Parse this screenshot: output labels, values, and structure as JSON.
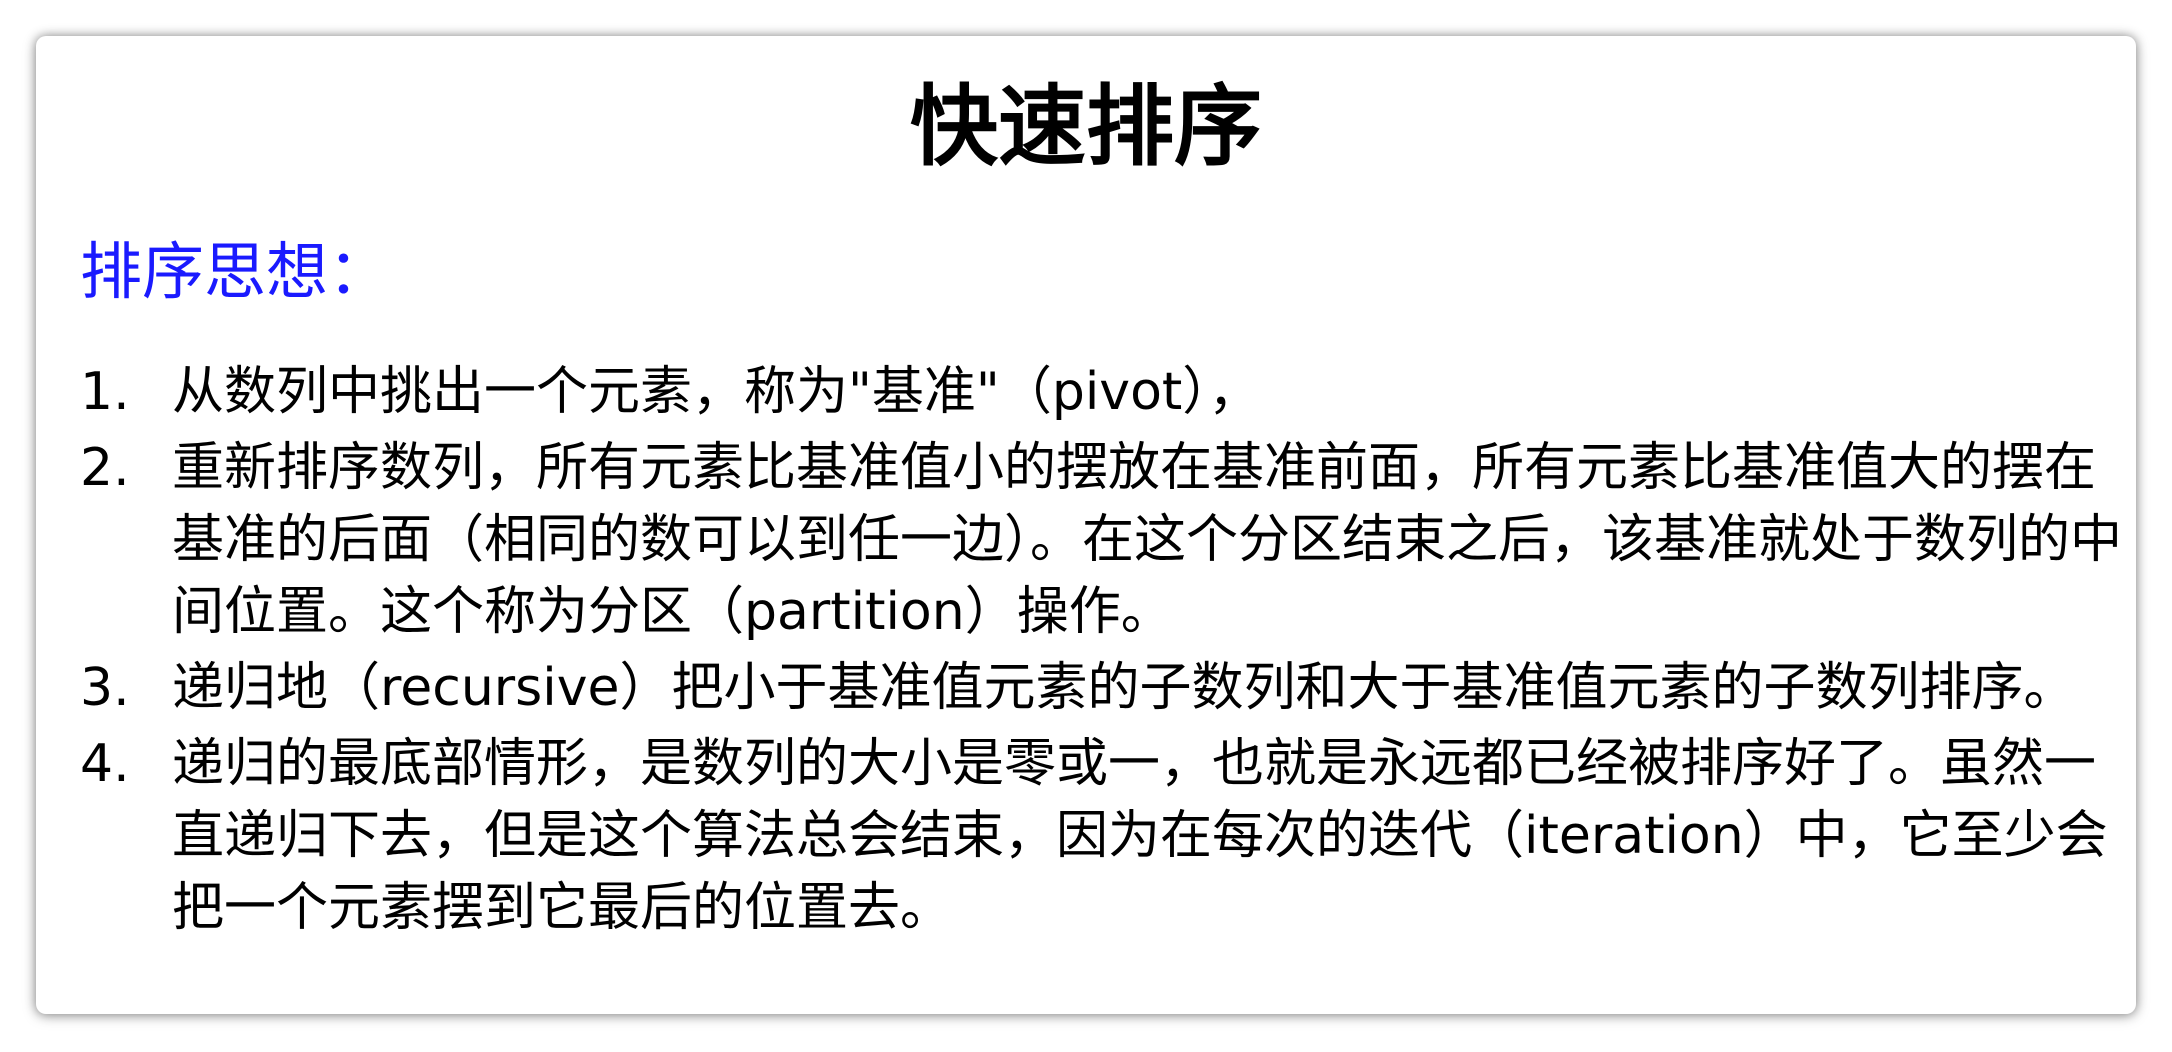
{
  "slide": {
    "title": "快速排序",
    "heading": "排序思想：",
    "steps": [
      {
        "number": "1.",
        "text": "从数列中挑出一个元素，称为\"基准\"（pivot），"
      },
      {
        "number": "2.",
        "text": "重新排序数列，所有元素比基准值小的摆放在基准前面，所有元素比基准值大的摆在基准的后面（相同的数可以到任一边）。在这个分区结束之后，该基准就处于数列的中间位置。这个称为分区（partition）操作。"
      },
      {
        "number": "3.",
        "text": "递归地（recursive）把小于基准值元素的子数列和大于基准值元素的子数列排序。"
      },
      {
        "number": "4.",
        "text": "递归的最底部情形，是数列的大小是零或一，也就是永远都已经被排序好了。虽然一直递归下去，但是这个算法总会结束，因为在每次的迭代（iteration）中，它至少会把一个元素摆到它最后的位置去。"
      }
    ]
  }
}
